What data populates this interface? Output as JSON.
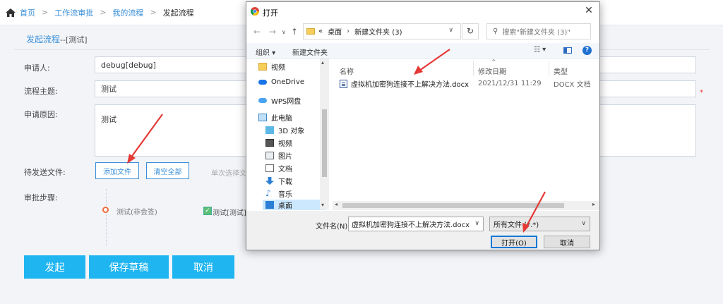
{
  "breadcrumb": {
    "home": "首页",
    "items": [
      "工作流审批",
      "我的流程"
    ],
    "current": "发起流程"
  },
  "form": {
    "title": "发起流程",
    "subtitle": "--[测试]",
    "applicant_label": "申请人:",
    "applicant_value": "debug[debug]",
    "subject_label": "流程主题:",
    "subject_value": "测试",
    "reason_label": "申请原因:",
    "reason_value": "测试",
    "pending_label": "待发送文件:",
    "add_file": "添加文件",
    "clear_all": "清空全部",
    "single_hint": "单次选择文",
    "steps_label": "审批步骤:",
    "step1": "测试(非会签)",
    "step2": "测试[测试]",
    "required_mark": "*"
  },
  "actions": {
    "submit": "发起",
    "save_draft": "保存草稿",
    "cancel": "取消"
  },
  "dialog": {
    "title": "打开",
    "address": {
      "root": "«",
      "parts": [
        "桌面",
        "新建文件夹 (3)"
      ]
    },
    "search_placeholder": "搜索\"新建文件夹 (3)\"",
    "toolbar": {
      "organize": "组织 ▾",
      "new_folder": "新建文件夹"
    },
    "nav_items": [
      "视频",
      "OneDrive",
      "WPS网盘",
      "此电脑",
      "3D 对象",
      "视频",
      "图片",
      "文档",
      "下载",
      "音乐",
      "桌面"
    ],
    "columns": {
      "name": "名称",
      "modified": "修改日期",
      "type": "类型"
    },
    "files": [
      {
        "name": "虚拟机加密狗连接不上解决方法.docx",
        "modified": "2021/12/31 11:29",
        "type": "DOCX 文档"
      }
    ],
    "filename_label": "文件名(N):",
    "filename_value": "虚拟机加密狗连接不上解决方法.docx",
    "filetype_value": "所有文件 (*.*)",
    "open_button": "打开(O)",
    "cancel_button": "取消"
  },
  "colors": {
    "accent": "#1eb5f0",
    "link": "#3a8fd8",
    "annotation": "#e53935"
  }
}
